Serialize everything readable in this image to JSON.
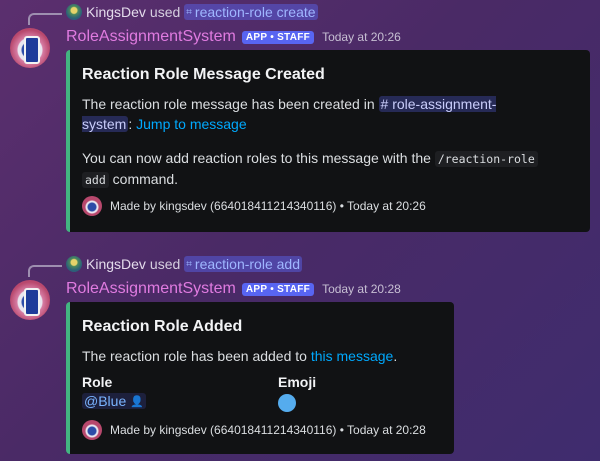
{
  "messages": [
    {
      "reply": {
        "user": "KingsDev",
        "verb": "used",
        "command": "reaction-role create"
      },
      "author": "RoleAssignmentSystem",
      "badge": "APP • STAFF",
      "time": "Today at 20:26",
      "embed": {
        "accent": "#43b581",
        "title": "Reaction Role Message Created",
        "line1_prefix": "The reaction role message has been created in",
        "channel_line1": "# role-assignment-",
        "channel_line2": "system",
        "line2_sep": ":",
        "jump_link": "Jump to message",
        "line3_prefix": "You can now add reaction roles to this message with the",
        "code_a": "/reaction-role",
        "code_b": "add",
        "line4_suffix": "command.",
        "footer": "Made by kingsdev (664018411214340116) • Today at 20:26"
      }
    },
    {
      "reply": {
        "user": "KingsDev",
        "verb": "used",
        "command": "reaction-role add"
      },
      "author": "RoleAssignmentSystem",
      "badge": "APP • STAFF",
      "time": "Today at 20:28",
      "embed": {
        "accent": "#43b581",
        "title": "Reaction Role Added",
        "line1_prefix": "The reaction role has been added to",
        "link": "this message",
        "line1_suffix": ".",
        "fields": [
          {
            "name": "Role",
            "value": "@Blue"
          },
          {
            "name": "Emoji",
            "value_icon": "blue-circle-emoji"
          }
        ],
        "footer": "Made by kingsdev (664018411214340116) • Today at 20:28"
      }
    }
  ]
}
